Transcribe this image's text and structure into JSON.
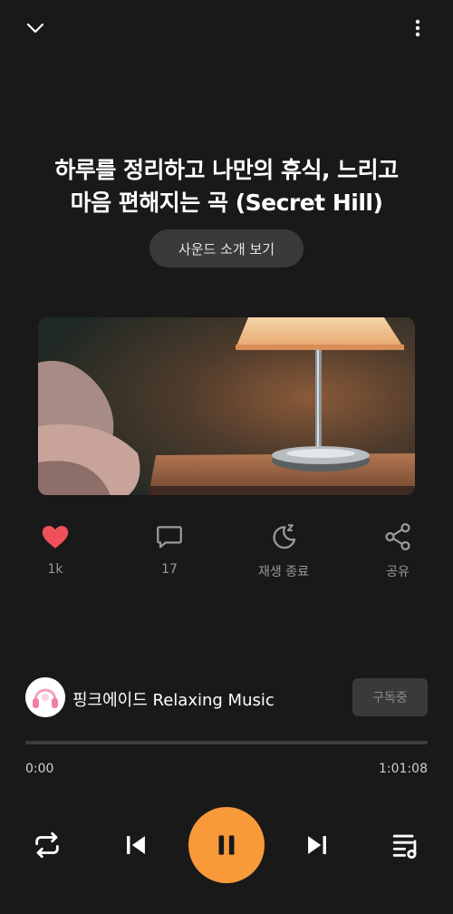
{
  "track": {
    "title_line1": "하루를 정리하고 나만의 휴식, 느리고",
    "title_line2": "마음 편해지는 곡 (Secret Hill)",
    "intro_button": "사운드 소개 보기"
  },
  "actions": {
    "like_count": "1k",
    "comment_count": "17",
    "sleep_timer_label": "재생 종료",
    "share_label": "공유"
  },
  "channel": {
    "name": "핑크에이드 Relaxing Music",
    "subscribe_label": "구독중"
  },
  "player": {
    "current_time": "0:00",
    "total_time": "1:01:08",
    "progress": 0.0,
    "state": "playing"
  },
  "icons": {
    "collapse": "chevron-down-icon",
    "more": "more-vertical-icon",
    "like": "heart-icon",
    "comment": "comment-icon",
    "sleep": "moon-icon",
    "share": "share-icon",
    "repeat": "repeat-icon",
    "previous": "skip-previous-icon",
    "pause": "pause-icon",
    "next": "skip-next-icon",
    "queue": "playlist-icon"
  },
  "colors": {
    "background": "#191919",
    "accent": "#f89a3a",
    "like": "#f0505a",
    "muted_text": "#9a9a9a"
  }
}
